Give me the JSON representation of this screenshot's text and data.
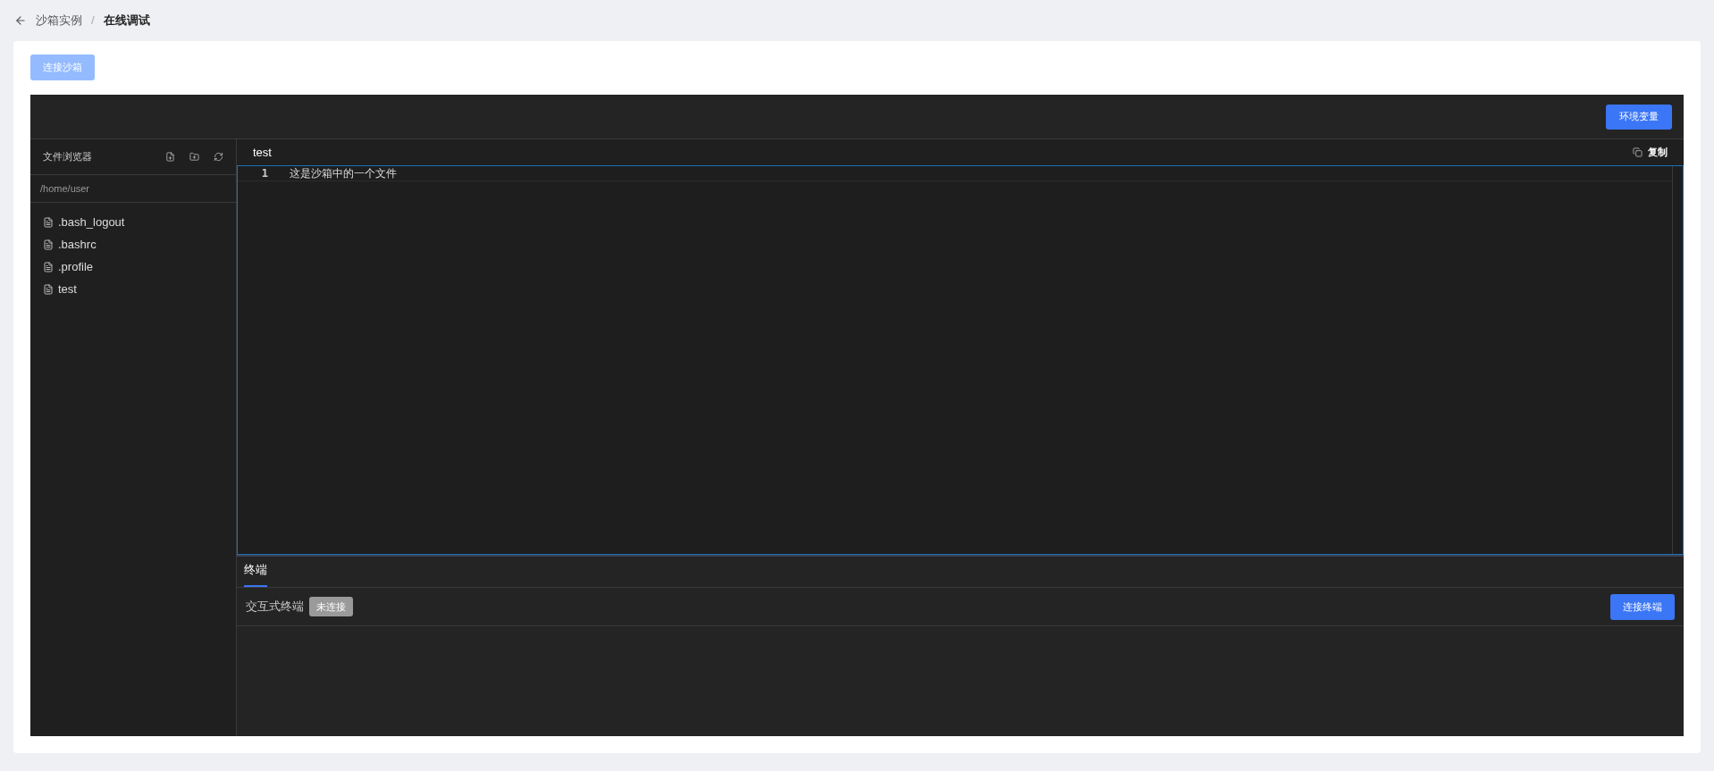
{
  "breadcrumb": {
    "items": [
      {
        "label": "沙箱实例",
        "current": false
      },
      {
        "label": "在线调试",
        "current": true
      }
    ],
    "separator": "/"
  },
  "connect_button": {
    "label": "连接沙箱",
    "disabled": true
  },
  "toolbar": {
    "env_button": "环境变量"
  },
  "file_browser": {
    "title": "文件浏览器",
    "path": "/home/user",
    "files": [
      {
        "name": ".bash_logout"
      },
      {
        "name": ".bashrc"
      },
      {
        "name": ".profile"
      },
      {
        "name": "test"
      }
    ]
  },
  "editor": {
    "tab": "test",
    "copy": "复制",
    "lines": [
      {
        "number": "1",
        "text": "这是沙箱中的一个文件"
      }
    ]
  },
  "terminal": {
    "tabs": [
      {
        "label": "终端",
        "selected": true
      }
    ],
    "label": "交互式终端",
    "status": {
      "label": "未连接",
      "connected": false
    },
    "connect_button": "连接终端"
  }
}
